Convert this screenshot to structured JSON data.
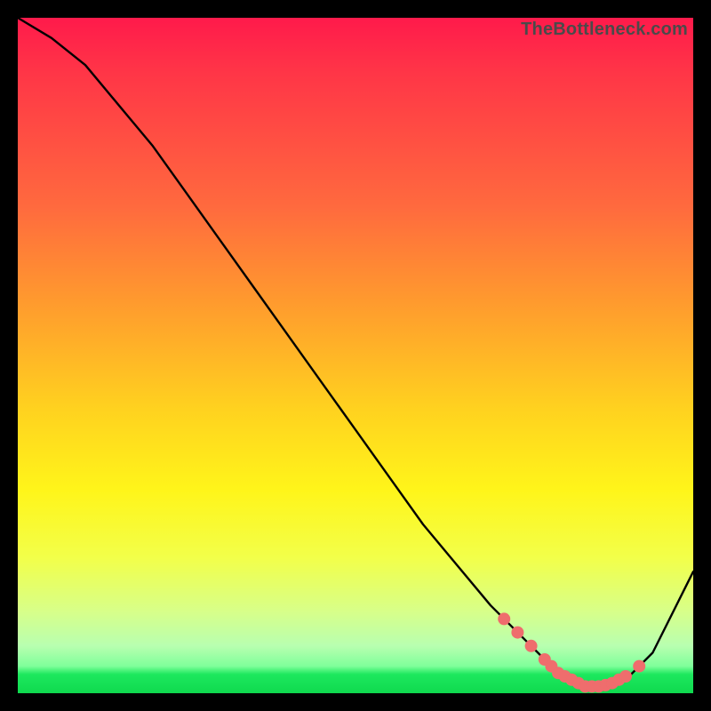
{
  "watermark": "TheBottleneck.com",
  "colors": {
    "curve_stroke": "#000000",
    "marker_fill": "#ef6d6d",
    "marker_stroke": "#ef6d6d"
  },
  "chart_data": {
    "type": "line",
    "title": "",
    "xlabel": "",
    "ylabel": "",
    "xlim": [
      0,
      100
    ],
    "ylim": [
      0,
      100
    ],
    "series": [
      {
        "name": "bottleneck-curve",
        "x": [
          0,
          5,
          10,
          15,
          20,
          25,
          30,
          35,
          40,
          45,
          50,
          55,
          60,
          65,
          70,
          75,
          78,
          80,
          82,
          84,
          86,
          88,
          90,
          92,
          94,
          100
        ],
        "y": [
          100,
          97,
          93,
          87,
          81,
          74,
          67,
          60,
          53,
          46,
          39,
          32,
          25,
          19,
          13,
          8,
          5,
          3,
          2,
          1,
          1,
          1,
          2,
          4,
          6,
          18
        ]
      }
    ],
    "markers": {
      "name": "highlight-dots",
      "x": [
        72,
        74,
        76,
        78,
        79,
        80,
        81,
        82,
        83,
        84,
        85,
        86,
        87,
        88,
        89,
        90,
        92
      ],
      "y": [
        11,
        9,
        7,
        5,
        4,
        3,
        2.5,
        2,
        1.5,
        1,
        1,
        1,
        1.2,
        1.5,
        2,
        2.5,
        4
      ]
    }
  }
}
